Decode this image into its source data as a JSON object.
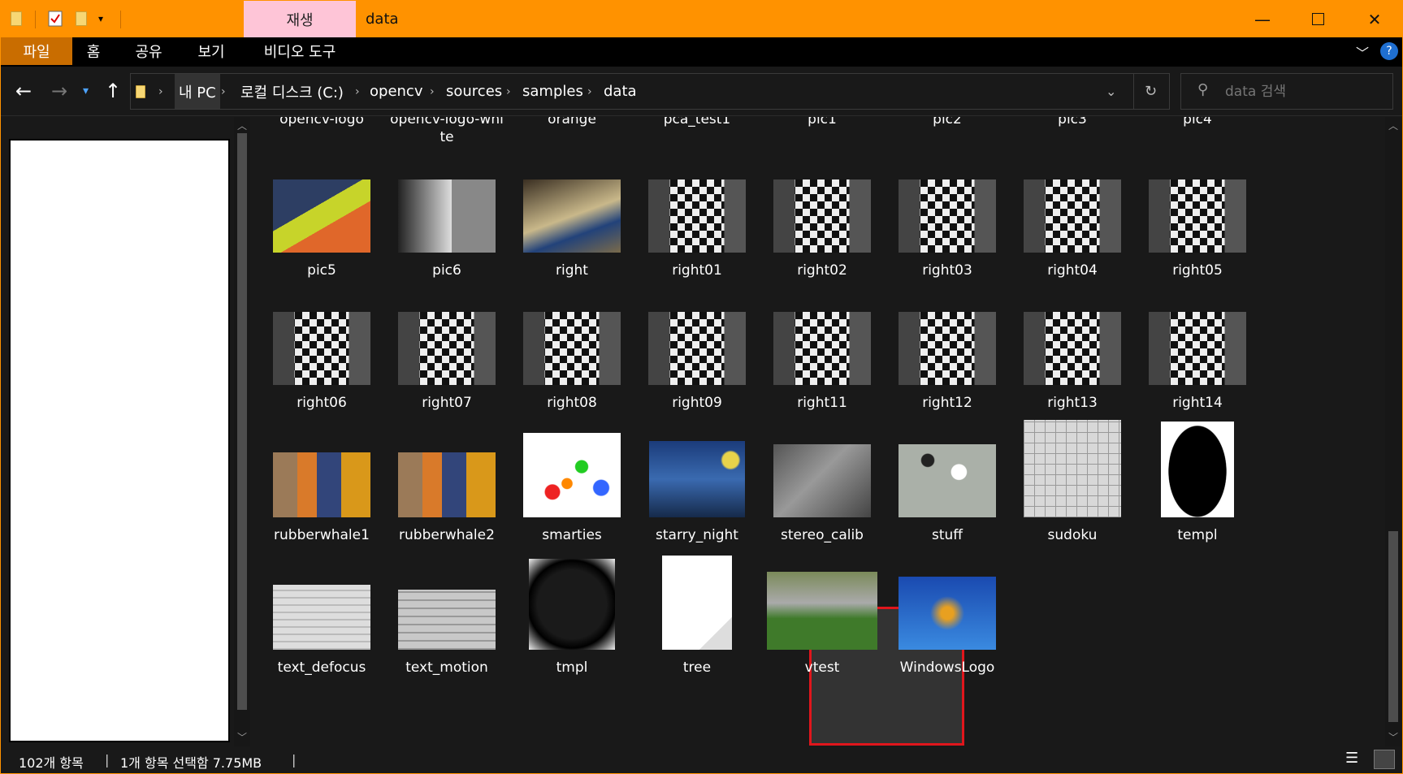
{
  "window": {
    "title": "data",
    "context_tab": "재생"
  },
  "ribbon": {
    "tabs": [
      "파일",
      "홈",
      "공유",
      "보기",
      "비디오 도구"
    ]
  },
  "address": {
    "crumbs": [
      "내 PC",
      "로컬 디스크 (C:)",
      "opencv",
      "sources",
      "samples",
      "data"
    ]
  },
  "search": {
    "placeholder": "data 검색"
  },
  "partial_row": [
    "opencv-logo",
    "opencv-logo-white",
    "orange",
    "pca_test1",
    "pic1",
    "pic2",
    "pic3",
    "pic4"
  ],
  "items": [
    {
      "name": "pic5"
    },
    {
      "name": "pic6"
    },
    {
      "name": "right"
    },
    {
      "name": "right01"
    },
    {
      "name": "right02"
    },
    {
      "name": "right03"
    },
    {
      "name": "right04"
    },
    {
      "name": "right05"
    },
    {
      "name": "right06"
    },
    {
      "name": "right07"
    },
    {
      "name": "right08"
    },
    {
      "name": "right09"
    },
    {
      "name": "right11"
    },
    {
      "name": "right12"
    },
    {
      "name": "right13"
    },
    {
      "name": "right14"
    },
    {
      "name": "rubberwhale1"
    },
    {
      "name": "rubberwhale2"
    },
    {
      "name": "smarties"
    },
    {
      "name": "starry_night"
    },
    {
      "name": "stereo_calib"
    },
    {
      "name": "stuff"
    },
    {
      "name": "sudoku"
    },
    {
      "name": "templ"
    },
    {
      "name": "text_defocus"
    },
    {
      "name": "text_motion"
    },
    {
      "name": "tmpl"
    },
    {
      "name": "tree"
    },
    {
      "name": "vtest"
    },
    {
      "name": "WindowsLogo"
    }
  ],
  "selected_item": "vtest",
  "status": {
    "count": "102개 항목",
    "selection": "1개 항목 선택함 7.75MB"
  },
  "colors": {
    "accent": "#ff9200",
    "selection_border": "#e0161c",
    "context_tab": "#fec5d7"
  }
}
